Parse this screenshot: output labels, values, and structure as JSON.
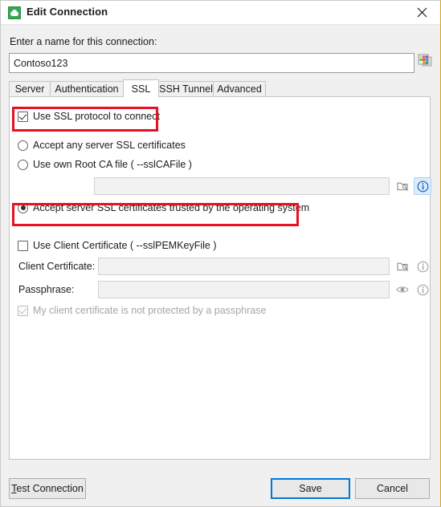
{
  "window": {
    "title": "Edit Connection",
    "app_icon": "mysql-dolphin-icon",
    "close_icon": "close-icon",
    "accent_color": "#d6a324"
  },
  "name_section": {
    "label": "Enter a name for this connection:",
    "value": "Contoso123",
    "placeholder": "",
    "palette_icon": "color-palette-icon"
  },
  "tabs": [
    {
      "label": "Server",
      "active": false
    },
    {
      "label": "Authentication",
      "active": false
    },
    {
      "label": "SSL",
      "active": true
    },
    {
      "label": "SSH Tunnel",
      "active": false
    },
    {
      "label": "Advanced",
      "active": false
    }
  ],
  "ssl": {
    "use_ssl": {
      "label": "Use SSL protocol to connect",
      "checked": true,
      "highlighted": true
    },
    "radio_group": [
      {
        "label": "Accept any server SSL certificates",
        "selected": false,
        "highlighted": false
      },
      {
        "label": "Use own Root CA file ( --sslCAFile )",
        "selected": false,
        "highlighted": false
      },
      {
        "label": "Accept server SSL certificates trusted by the operating system",
        "selected": true,
        "highlighted": true
      }
    ],
    "ca_file": {
      "value": "",
      "browse_icon": "browse-folder-icon",
      "info_icon": "info-icon",
      "info_highlighted": true
    },
    "client_cert": {
      "checkbox_label": "Use Client Certificate ( --sslPEMKeyFile )",
      "checkbox_checked": false,
      "cert_label": "Client Certificate:",
      "cert_value": "",
      "cert_browse_icon": "browse-folder-icon",
      "cert_info_icon": "info-icon",
      "passphrase_label": "Passphrase:",
      "passphrase_value": "",
      "passphrase_eye_icon": "eye-icon",
      "passphrase_info_icon": "info-icon",
      "no_passphrase": {
        "label": "My client certificate is not protected by a passphrase",
        "checked": true,
        "disabled": true
      }
    }
  },
  "footer": {
    "test_connection": {
      "prefix": "T",
      "rest": "est Connection"
    },
    "save": "Save",
    "cancel": "Cancel"
  },
  "colors": {
    "annotation_red": "#e81123",
    "focus_blue": "#0078d7",
    "title_icon_green": "#34a853"
  }
}
